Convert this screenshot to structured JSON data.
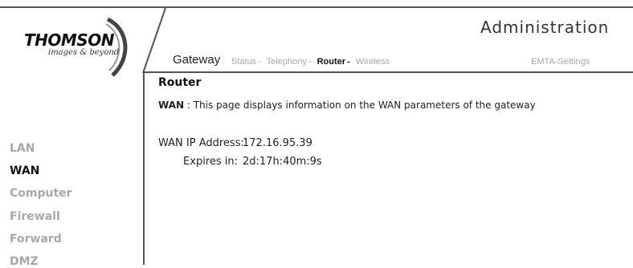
{
  "logo": {
    "brand": "THOMSON",
    "tagline": "images & beyond"
  },
  "header": {
    "title": "Administration"
  },
  "nav": {
    "gateway": "Gateway",
    "links": [
      {
        "label": "Status",
        "sep": "-"
      },
      {
        "label": "Telephony",
        "sep": "-"
      },
      {
        "label": "Router",
        "sep": "-"
      },
      {
        "label": "Wireless",
        "sep": ""
      }
    ],
    "emta": "EMTA-Settings",
    "active": "Router"
  },
  "sidebar": {
    "items": [
      {
        "label": "LAN"
      },
      {
        "label": "WAN"
      },
      {
        "label": "Computer"
      },
      {
        "label": "Firewall"
      },
      {
        "label": "Forward"
      },
      {
        "label": "DMZ"
      }
    ],
    "active": "WAN"
  },
  "main": {
    "title": "Router",
    "desc_bold": "WAN",
    "desc_text": " : This page displays information on the WAN parameters of the gateway",
    "fields": [
      {
        "label": "WAN IP Address:",
        "value": "172.16.95.39"
      },
      {
        "label": "Expires in:",
        "value": "2d:17h:40m:9s"
      }
    ]
  }
}
